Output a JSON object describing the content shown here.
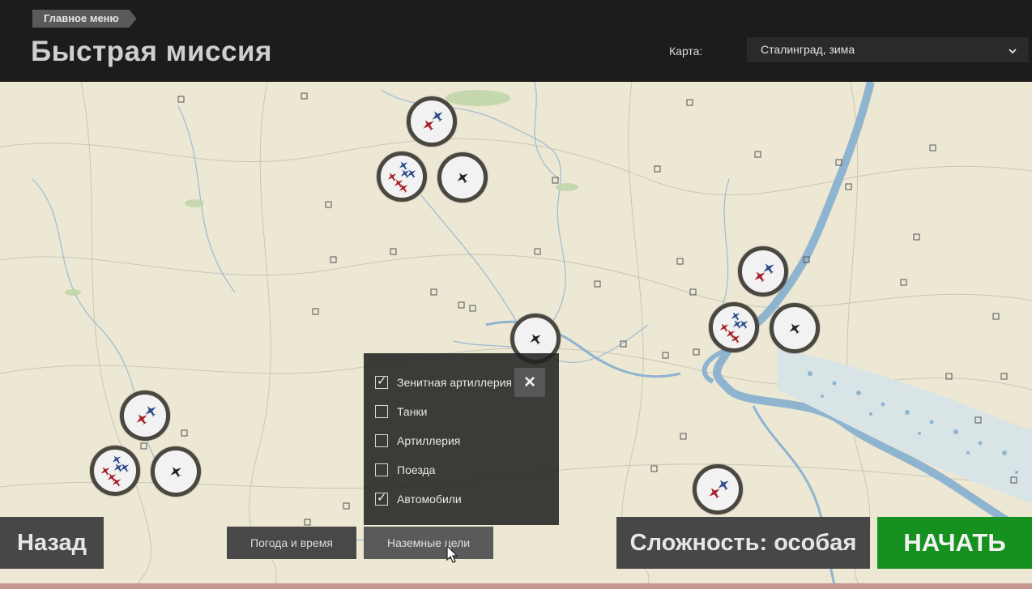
{
  "header": {
    "breadcrumb": "Главное меню",
    "title": "Быстрая миссия",
    "map_label": "Карта:",
    "map_value": "Сталинград, зима"
  },
  "ground_targets": {
    "items": [
      {
        "label": "Зенитная артиллерия",
        "checked": true
      },
      {
        "label": "Танки",
        "checked": false
      },
      {
        "label": "Артиллерия",
        "checked": false
      },
      {
        "label": "Поезда",
        "checked": false
      },
      {
        "label": "Автомобили",
        "checked": true
      }
    ],
    "close_icon": "close-icon"
  },
  "buttons": {
    "back": "Назад",
    "weather": "Погода и время",
    "ground_targets": "Наземные цели",
    "difficulty": "Сложность: особая",
    "start": "НАЧАТЬ"
  },
  "colors": {
    "start": "#16911f",
    "allied_plane": "#2e4e8c",
    "enemy_plane": "#a3212a",
    "neutral_plane": "#222222",
    "river": "#8fb4cf",
    "map_bg": "#ece8d3"
  }
}
